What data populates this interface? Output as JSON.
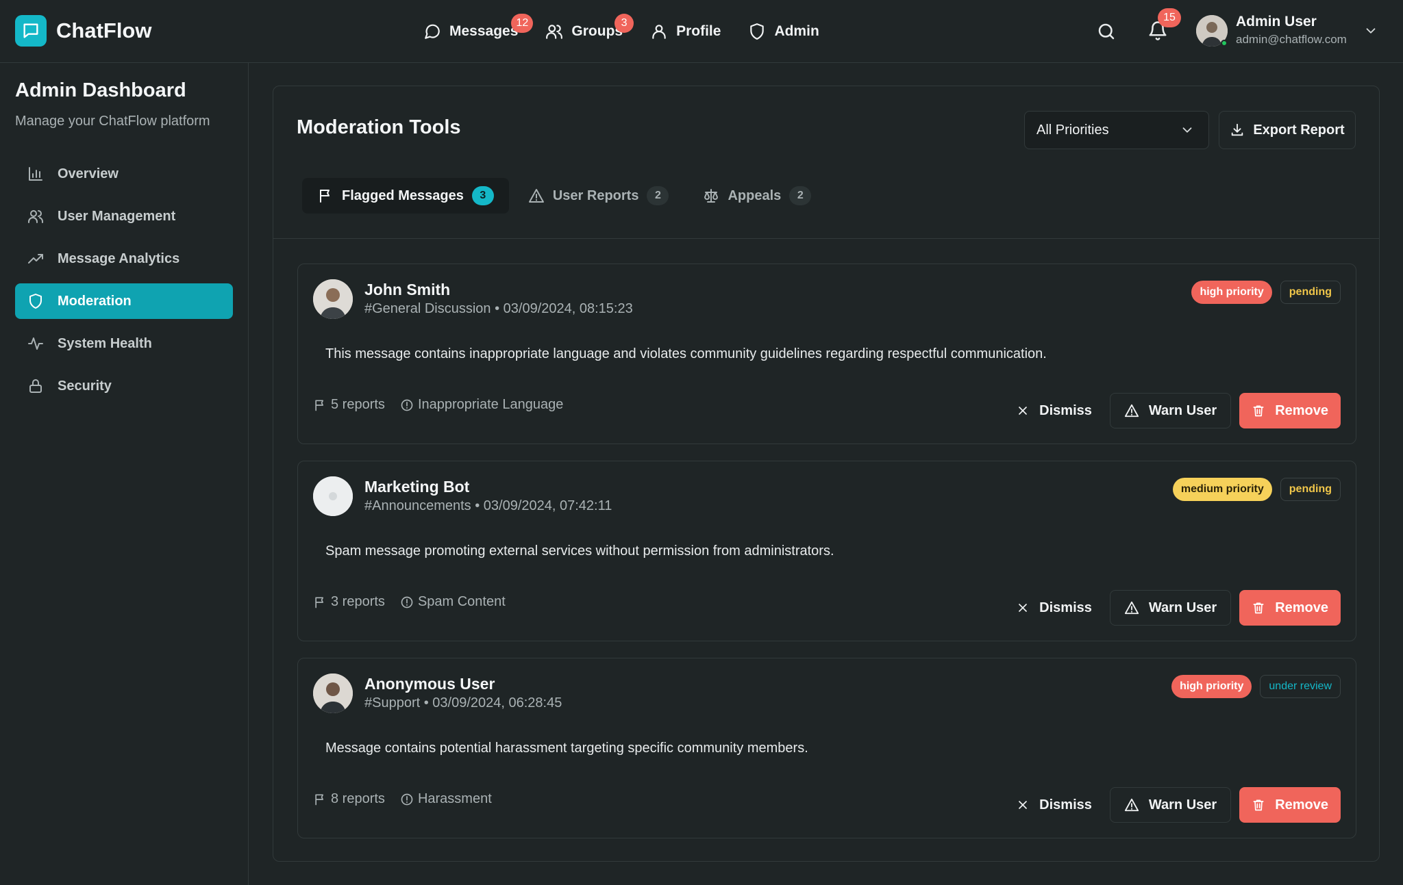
{
  "app": {
    "name": "ChatFlow",
    "logo_icon": "chat-bubble-icon",
    "accent_color": "#14b8c8"
  },
  "nav": {
    "items": [
      {
        "label": "Messages",
        "icon": "message-circle-icon",
        "badge": "12"
      },
      {
        "label": "Groups",
        "icon": "users-icon",
        "badge": "3"
      },
      {
        "label": "Profile",
        "icon": "user-icon",
        "badge": ""
      },
      {
        "label": "Admin",
        "icon": "shield-icon",
        "badge": ""
      }
    ],
    "notifications_count": "15"
  },
  "user": {
    "name": "Admin User",
    "email": "admin@chatflow.com"
  },
  "sidebar": {
    "title": "Admin Dashboard",
    "subtitle": "Manage your ChatFlow platform",
    "items": [
      {
        "label": "Overview",
        "icon": "bar-chart-icon",
        "active": false
      },
      {
        "label": "User Management",
        "icon": "users-icon",
        "active": false
      },
      {
        "label": "Message Analytics",
        "icon": "trending-up-icon",
        "active": false
      },
      {
        "label": "Moderation",
        "icon": "shield-icon",
        "active": true
      },
      {
        "label": "System Health",
        "icon": "activity-icon",
        "active": false
      },
      {
        "label": "Security",
        "icon": "lock-icon",
        "active": false
      }
    ]
  },
  "main": {
    "title": "Moderation Tools",
    "priority_filter": "All Priorities",
    "export_label": "Export Report",
    "tabs": [
      {
        "label": "Flagged Messages",
        "count": "3",
        "icon": "flag-icon",
        "active": true
      },
      {
        "label": "User Reports",
        "count": "2",
        "icon": "alert-triangle-icon",
        "active": false
      },
      {
        "label": "Appeals",
        "count": "2",
        "icon": "scale-icon",
        "active": false
      }
    ],
    "actions": {
      "dismiss": "Dismiss",
      "warn": "Warn User",
      "remove": "Remove"
    },
    "flags": [
      {
        "user": "John Smith",
        "channel": "#General Discussion",
        "timestamp": "03/09/2024, 08:15:23",
        "priority": "high priority",
        "status": "pending",
        "message": "This message contains inappropriate language and violates community guidelines regarding respectful communication.",
        "reports": "5 reports",
        "reason": "Inappropriate Language"
      },
      {
        "user": "Marketing Bot",
        "channel": "#Announcements",
        "timestamp": "03/09/2024, 07:42:11",
        "priority": "medium priority",
        "status": "pending",
        "message": "Spam message promoting external services without permission from administrators.",
        "reports": "3 reports",
        "reason": "Spam Content"
      },
      {
        "user": "Anonymous User",
        "channel": "#Support",
        "timestamp": "03/09/2024, 06:28:45",
        "priority": "high priority",
        "status": "under review",
        "message": "Message contains potential harassment targeting specific community members.",
        "reports": "8 reports",
        "reason": "Harassment"
      }
    ]
  },
  "colors": {
    "background": "#1f2526",
    "accent": "#14b8c8",
    "danger": "#f0655b",
    "warning": "#f6d15a",
    "pending_text": "#f0c64a"
  }
}
